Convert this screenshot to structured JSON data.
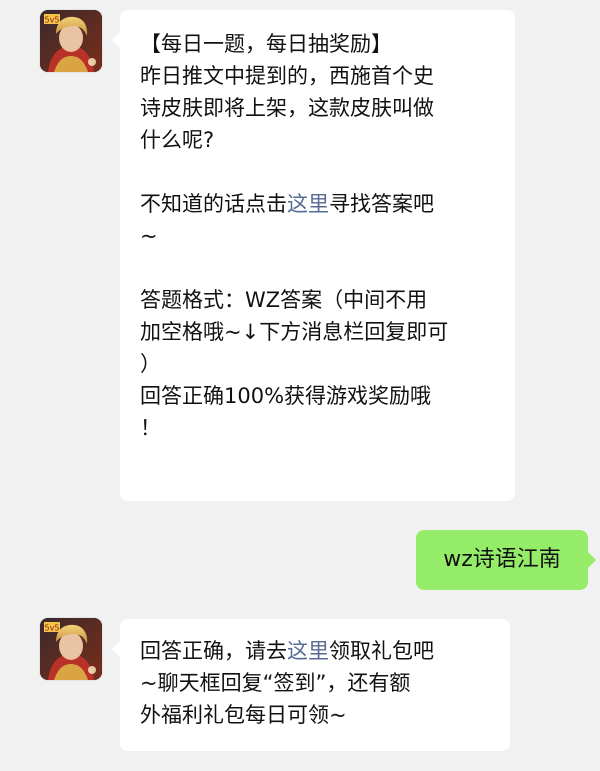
{
  "messages": [
    {
      "side": "left",
      "lines": [
        {
          "text": "【每日一题，每日抽奖励】"
        },
        {
          "text": "昨日推文中提到的，西施首个史"
        },
        {
          "text": "诗皮肤即将上架，这款皮肤叫做"
        },
        {
          "text": "什么呢?"
        },
        {
          "blank": true
        },
        {
          "pre": "不知道的话点击",
          "link": "这里",
          "post": "寻找答案吧"
        },
        {
          "text": "~"
        },
        {
          "blank": true
        },
        {
          "text": "答题格式：WZ答案（中间不用"
        },
        {
          "text": "加空格哦~↓下方消息栏回复即可"
        },
        {
          "text": "）"
        },
        {
          "text": "回答正确100%获得游戏奖励哦"
        },
        {
          "text": "！"
        }
      ]
    },
    {
      "side": "right",
      "text": "wz诗语江南",
      "color": "#95ec69"
    },
    {
      "side": "left",
      "lines": [
        {
          "pre": "回答正确，请去",
          "link": "这里",
          "post": "领取礼包吧"
        },
        {
          "text": "~聊天框回复“签到”，还有额"
        },
        {
          "text": "外福利礼包每日可领~"
        }
      ]
    }
  ],
  "theme": {
    "background": "#f1f1f1",
    "bubble_left": "#ffffff",
    "bubble_right": "#95ec69",
    "link_color": "#576b95"
  }
}
